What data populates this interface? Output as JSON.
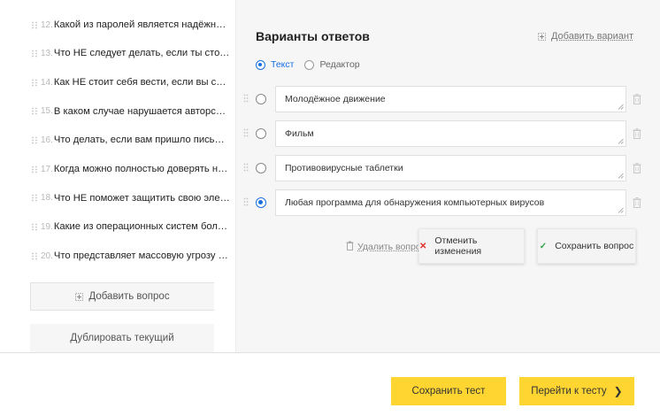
{
  "questions": [
    {
      "num": "12.",
      "text": "Какой из паролей является надёжным?"
    },
    {
      "num": "13.",
      "text": "Что НЕ следует делать, если ты столкнулся с тро..."
    },
    {
      "num": "14.",
      "text": "Как НЕ стоит себя вести, если вы стали жертвой ..."
    },
    {
      "num": "15.",
      "text": "В каком случае нарушается авторское право?"
    },
    {
      "num": "16.",
      "text": "Что делать, если вам пришло письмо о том, что..."
    },
    {
      "num": "17.",
      "text": "Когда можно полностью доверять новым онла..."
    },
    {
      "num": "18.",
      "text": "Что НЕ поможет защитить свою электронную п..."
    },
    {
      "num": "19.",
      "text": "Какие из операционных систем больше всего п..."
    },
    {
      "num": "20.",
      "text": "Что представляет массовую угрозу компьютерн..."
    }
  ],
  "left_actions": {
    "add_question": "Добавить вопрос",
    "duplicate": "Дублировать текущий"
  },
  "editor": {
    "title": "Варианты ответов",
    "add_variant": "Добавить вариант",
    "modes": [
      {
        "label": "Текст",
        "selected": true
      },
      {
        "label": "Редактор",
        "selected": false
      }
    ],
    "answers": [
      {
        "text": "Молодёжное движение",
        "correct": false
      },
      {
        "text": "Фильм",
        "correct": false
      },
      {
        "text": "Противовирусные таблетки",
        "correct": false
      },
      {
        "text": "Любая программа для обнаружения компьютерных вирусов",
        "correct": true
      }
    ],
    "delete_question": "Удалить вопрос",
    "cancel_changes": "Отменить изменения",
    "save_question": "Сохранить вопрос",
    "icons": {
      "cancel": "close-icon",
      "save": "check-icon",
      "delete": "trash-icon",
      "add": "plus-icon"
    }
  },
  "footer": {
    "save_test": "Сохранить тест",
    "next": "Перейти к тесту",
    "next_icon": "chevron-right-icon"
  },
  "colors": {
    "accent_blue": "#1a6fe0",
    "yellow_button": "#ffd531",
    "cancel_red": "#e0312b",
    "save_green": "#2fa54a"
  }
}
